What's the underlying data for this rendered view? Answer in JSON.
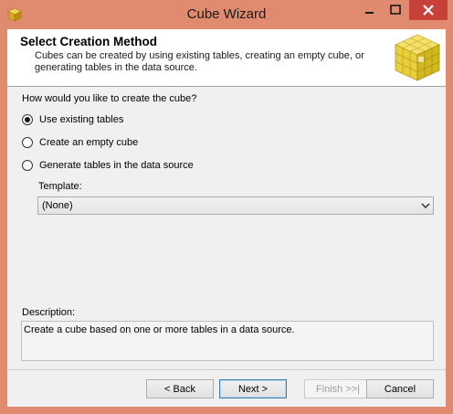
{
  "window": {
    "title": "Cube Wizard"
  },
  "header": {
    "title": "Select Creation Method",
    "description": "Cubes can be created by using existing tables, creating an empty cube, or generating tables in the data source."
  },
  "question": "How would you like to create the cube?",
  "options": [
    {
      "label": "Use existing tables",
      "selected": true
    },
    {
      "label": "Create an empty cube",
      "selected": false
    },
    {
      "label": "Generate tables in the data source",
      "selected": false
    }
  ],
  "template": {
    "label": "Template:",
    "value": "(None)"
  },
  "description": {
    "label": "Description:",
    "text": "Create a cube based on one or more tables in a data source."
  },
  "buttons": {
    "back": "< Back",
    "next": "Next >",
    "finish": "Finish >>|",
    "cancel": "Cancel"
  }
}
